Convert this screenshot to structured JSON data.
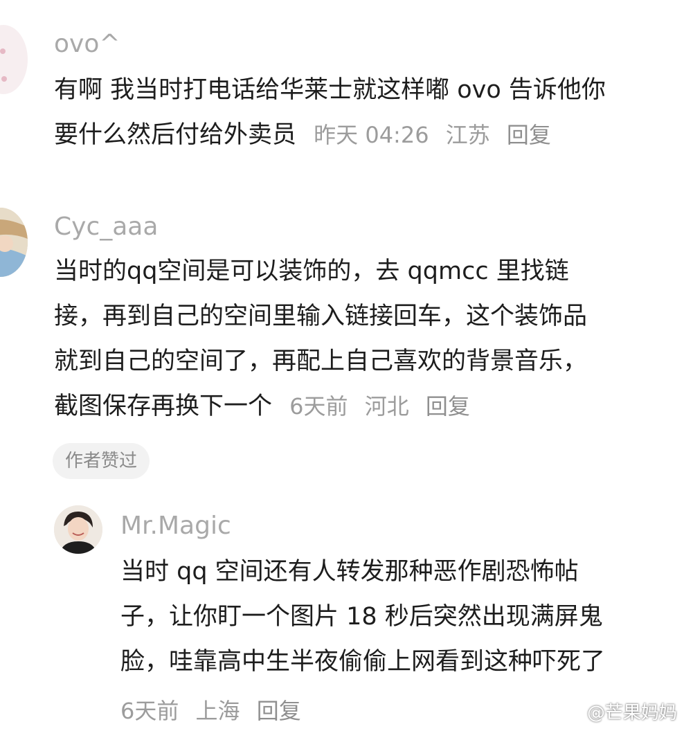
{
  "comments": [
    {
      "username": "ovo^",
      "lines": [
        "有啊 我当时打电话给华莱士就这样嘟 ovo 告诉他你",
        "要什么然后付给外卖员"
      ],
      "time": "昨天 04:26",
      "location": "江苏",
      "reply": "回复"
    },
    {
      "username": "Cyc_aaa",
      "lines": [
        "当时的qq空间是可以装饰的，去 qqmcc 里找链",
        "接，再到自己的空间里输入链接回车，这个装饰品",
        "就到自己的空间了，再配上自己喜欢的背景音乐，",
        "截图保存再换下一个"
      ],
      "time": "6天前",
      "location": "河北",
      "reply": "回复",
      "badge": "作者赞过"
    },
    {
      "username": "Mr.Magic",
      "lines": [
        "当时 qq 空间还有人转发那种恶作剧恐怖帖",
        "子，让你盯一个图片 18 秒后突然出现满屏鬼",
        "脸，哇靠高中生半夜偷偷上网看到这种吓死了"
      ],
      "time": "6天前",
      "location": "上海",
      "reply": "回复"
    }
  ],
  "watermark": "@芒果妈妈"
}
